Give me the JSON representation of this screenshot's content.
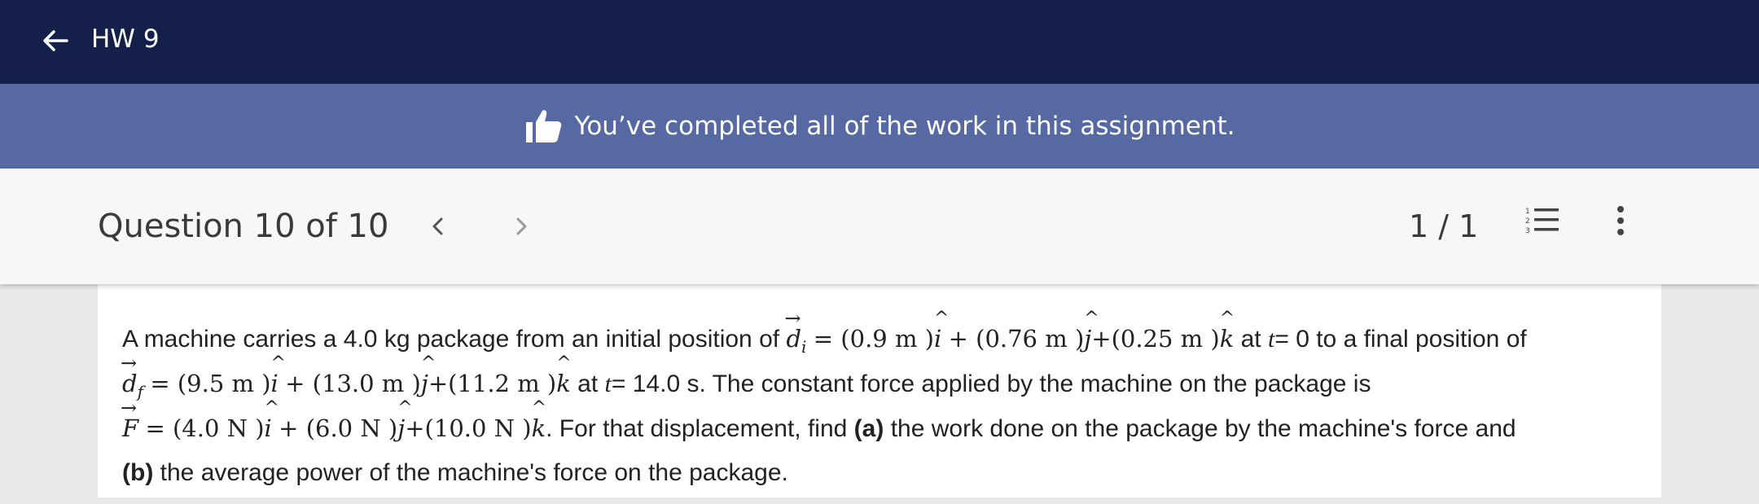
{
  "header": {
    "title": "HW 9",
    "back_icon": "arrow-left-icon"
  },
  "banner": {
    "text": "You’ve completed all of the work in this assignment.",
    "icon": "thumbs-up-icon"
  },
  "question_bar": {
    "counter": "Question 10 of 10",
    "score": "1 / 1",
    "prev_icon": "chevron-left-icon",
    "next_icon": "chevron-right-icon",
    "list_icon": "numbered-list-icon",
    "more_icon": "more-vertical-icon"
  },
  "question": {
    "line1_pre": "A machine carries a 4.0 kg package from an initial position of",
    "di_symbol": "d",
    "di_sub": "i",
    "di_expr_a": "= (0.9 m )",
    "di_expr_b": "+ (0.76 m )",
    "di_expr_c": "+(0.25 m )",
    "line1_post": "at",
    "t0": "t",
    "line1_post2": "= 0 to a final position of",
    "df_symbol": "d",
    "df_sub": "f",
    "df_expr_a": "= (9.5 m )",
    "df_expr_b": "+ (13.0 m )",
    "df_expr_c": "+(11.2 m )",
    "line2_post": "at",
    "t1": "t",
    "line2_post2": "= 14.0 s. The constant force applied by the machine on the package is",
    "F_symbol": "F",
    "F_expr_a": "= (4.0 N )",
    "F_expr_b": "+ (6.0 N )",
    "F_expr_c": "+(10.0 N )",
    "line3_post": ". For that displacement, find",
    "part_a_label": "(a)",
    "line3_post2": "the work done on the package by the machine's force and",
    "part_b_label": "(b)",
    "line4": "the average power of the machine's force on the package.",
    "unit_i": "i",
    "unit_j": "j",
    "unit_k": "k"
  }
}
